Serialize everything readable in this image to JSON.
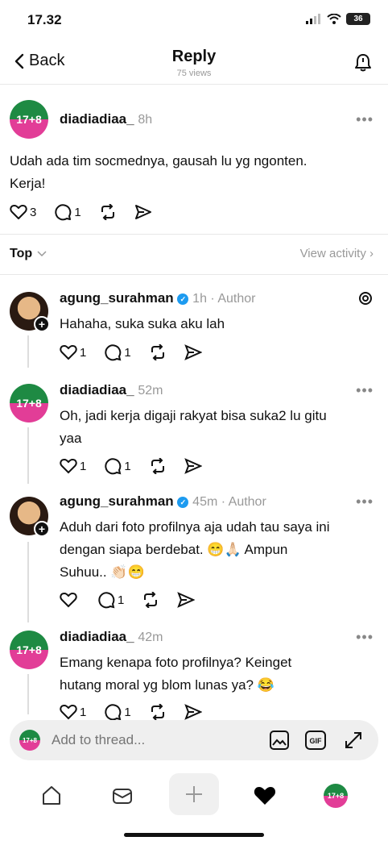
{
  "status": {
    "time": "17.32",
    "battery": "36"
  },
  "nav": {
    "back_label": "Back",
    "title": "Reply",
    "subtitle": "75 views"
  },
  "original_post": {
    "avatar_text": "17+8",
    "username": "diadiadiaa_",
    "time": "8h",
    "text_line1": "Udah ada tim socmednya, gausah lu yg ngonten.",
    "text_line2": "Kerja!",
    "likes": "3",
    "replies": "1"
  },
  "filter": {
    "sort_label": "Top",
    "activity_label": "View activity"
  },
  "replies": [
    {
      "username": "agung_surahman",
      "verified": true,
      "time": "1h",
      "tag": "Author",
      "line1": "Hahaha, suka suka aku lah",
      "line2": "",
      "line3": "",
      "likes": "1",
      "replies": "1"
    },
    {
      "avatar_text": "17+8",
      "username": "diadiadiaa_",
      "time": "52m",
      "line1": "Oh, jadi kerja digaji rakyat bisa suka2 lu gitu",
      "line2": "yaa",
      "likes": "1",
      "replies": "1"
    },
    {
      "username": "agung_surahman",
      "verified": true,
      "time": "45m",
      "tag": "Author",
      "line1": "Aduh dari foto profilnya aja udah tau saya ini",
      "line2": "dengan siapa berdebat. 😁🙏🏻 Ampun",
      "line3": "Suhuu.. 👏🏻😁",
      "likes": "",
      "replies": "1"
    },
    {
      "avatar_text": "17+8",
      "username": "diadiadiaa_",
      "time": "42m",
      "line1": "Emang kenapa foto profilnya? Keinget",
      "line2": "hutang moral yg blom lunas ya? 😂",
      "likes": "1",
      "replies": "1"
    }
  ],
  "compose": {
    "avatar_text": "17+8",
    "placeholder": "Add to thread...",
    "gif_label": "GIF"
  },
  "tabbar": {
    "profile_avatar_text": "17+8"
  },
  "icons": [
    "chevron-left-icon",
    "bell-icon",
    "heart-icon",
    "comment-icon",
    "repost-icon",
    "share-icon",
    "threads-logo-icon",
    "image-icon",
    "gif-icon",
    "expand-icon",
    "home-icon",
    "inbox-icon",
    "plus-icon",
    "heart-filled-icon"
  ]
}
